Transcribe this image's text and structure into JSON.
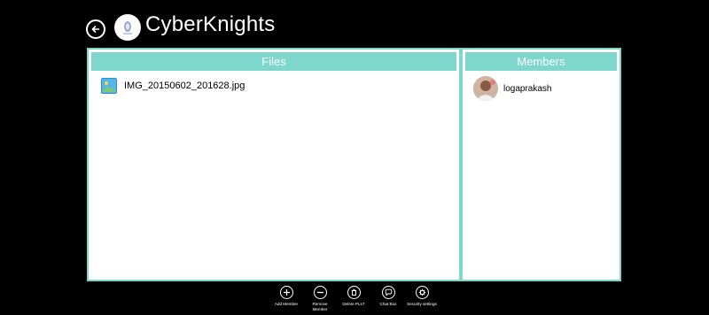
{
  "header": {
    "title": "CyberKnights"
  },
  "files_panel": {
    "header": "Files",
    "items": [
      {
        "name": "IMG_20150602_201628.jpg"
      }
    ]
  },
  "members_panel": {
    "header": "Members",
    "items": [
      {
        "name": "logaprakash"
      }
    ]
  },
  "app_bar": {
    "add_member": "Add Member",
    "remove_member": "Remove\nMember",
    "delete_plst": "Delete PLsT",
    "chat_box": "Chat Box",
    "security_settings": "Security settings"
  },
  "colors": {
    "accent": "#7dd7cc",
    "background": "#000000"
  }
}
